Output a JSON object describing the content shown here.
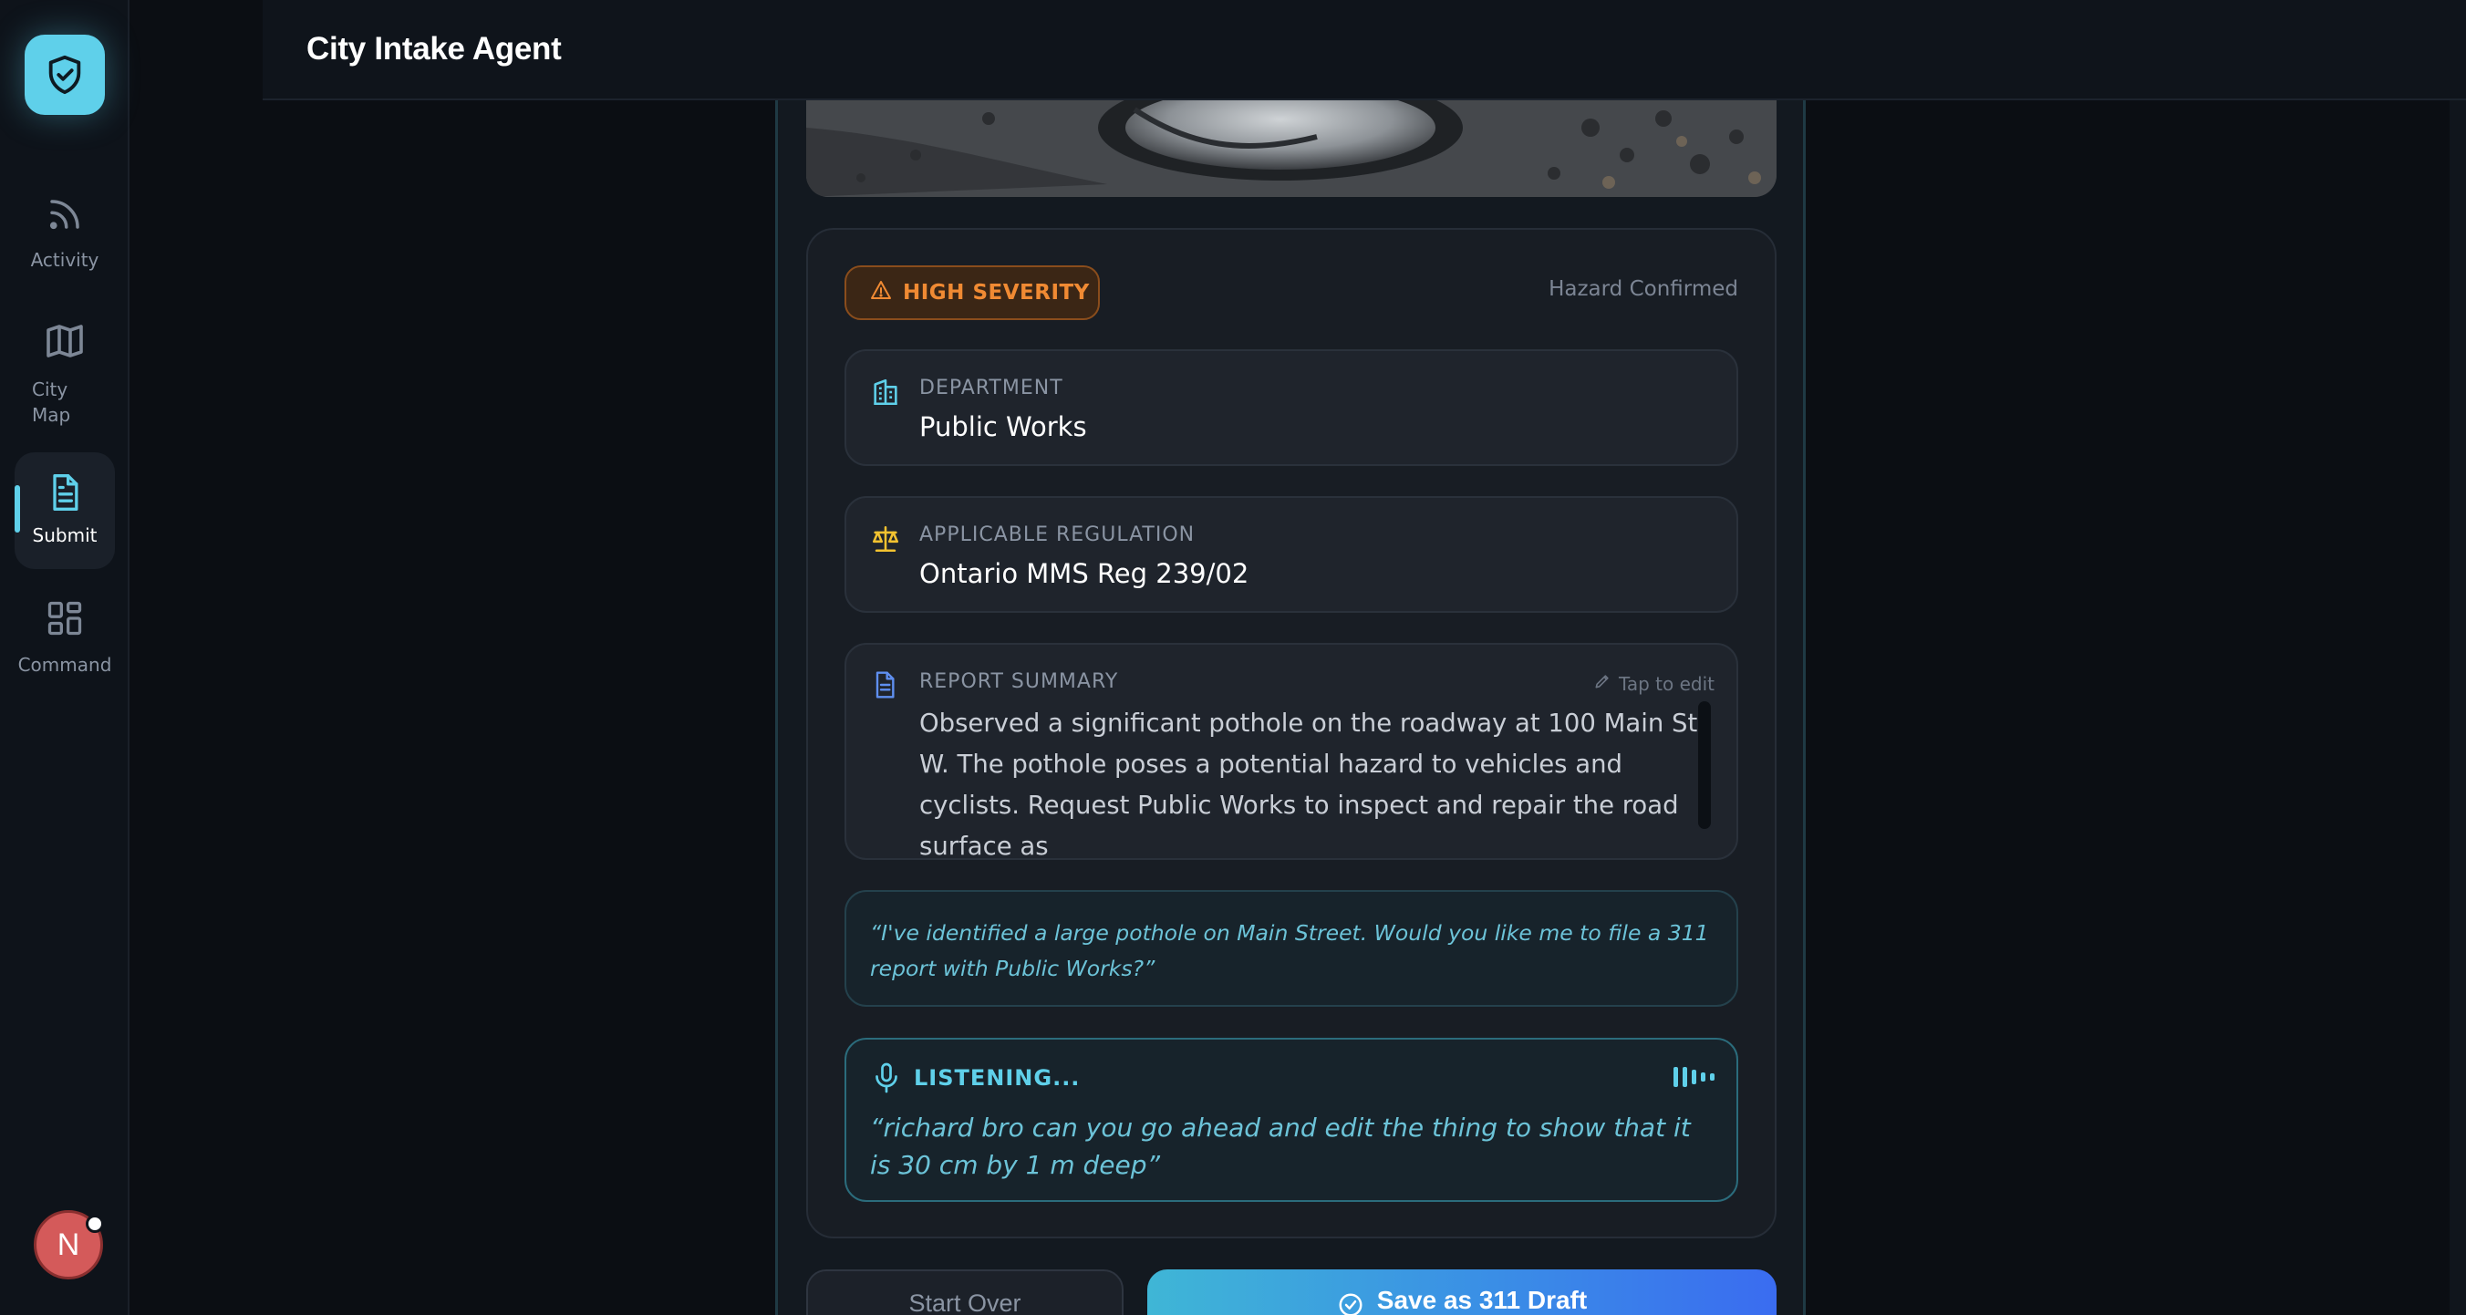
{
  "app": {
    "title": "City Intake Agent"
  },
  "sidebar": {
    "items": [
      {
        "label": "Activity",
        "icon": "rss-icon"
      },
      {
        "label": "City Map",
        "icon": "map-icon"
      },
      {
        "label": "Submit",
        "icon": "document-icon",
        "active": true
      },
      {
        "label": "Command",
        "icon": "grid-icon"
      }
    ],
    "avatar_initial": "N"
  },
  "report": {
    "severity": "HIGH SEVERITY",
    "status": "Hazard Confirmed",
    "department": {
      "label": "DEPARTMENT",
      "value": "Public Works"
    },
    "regulation": {
      "label": "APPLICABLE REGULATION",
      "value": "Ontario MMS Reg 239/02"
    },
    "summary": {
      "label": "REPORT SUMMARY",
      "edit_hint": "Tap to edit",
      "text": "Observed a significant pothole on the roadway at 100 Main St W. The pothole poses a potential hazard to vehicles and cyclists. Request Public Works to inspect and repair the road surface as"
    },
    "agent_quote": "“I've identified a large pothole on Main Street. Would you like me to file a 311 report with Public Works?”",
    "listening": {
      "label": "LISTENING...",
      "transcript": "“richard bro can you go ahead and edit the thing to show that it is 30 cm by 1 m deep”"
    }
  },
  "actions": {
    "start_over": "Start Over",
    "save_draft": "Save as 311 Draft"
  },
  "colors": {
    "accent": "#5fd0ea",
    "severity": "#f08a33",
    "regulation_icon": "#f2c230",
    "primary_gradient_start": "#3fb6d6",
    "primary_gradient_end": "#3a6cf0"
  }
}
